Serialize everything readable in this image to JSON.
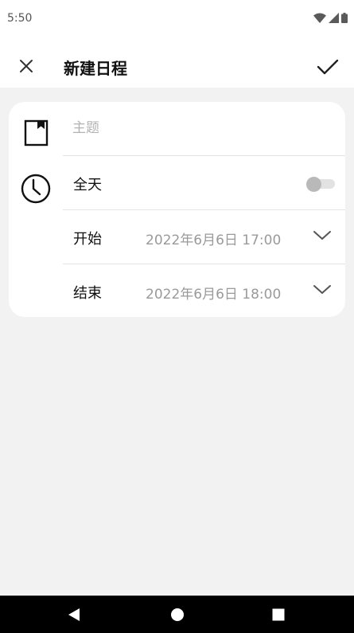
{
  "status_bar": {
    "time": "5:50",
    "icons": [
      "wifi-icon",
      "cell-signal-icon",
      "battery-icon"
    ]
  },
  "app_bar": {
    "title": "新建日程",
    "close_icon": "close-icon",
    "confirm_icon": "check-icon"
  },
  "form": {
    "subject": {
      "placeholder": "主题",
      "value": ""
    },
    "all_day": {
      "label": "全天",
      "enabled": false
    },
    "start": {
      "label": "开始",
      "value": "2022年6月6日 17:00"
    },
    "end": {
      "label": "结束",
      "value": "2022年6月6日 18:00"
    }
  },
  "nav_bar": {
    "icons": [
      "back-icon",
      "home-icon",
      "recents-icon"
    ]
  },
  "colors": {
    "background": "#f2f2f2",
    "card": "#ffffff",
    "placeholder": "#b3b3b3",
    "date_text": "#9a9a9a",
    "toggle_thumb": "#b9b9b9"
  }
}
